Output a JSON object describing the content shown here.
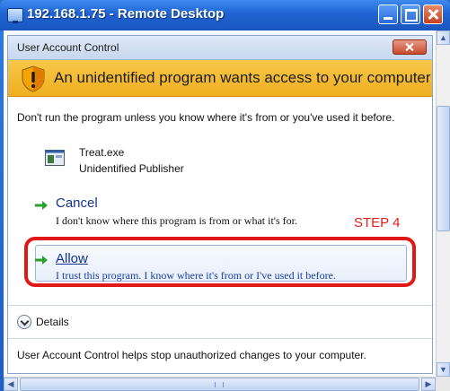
{
  "remote_desktop": {
    "title": "192.168.1.75 - Remote Desktop"
  },
  "uac": {
    "title": "User Account Control",
    "banner": "An unidentified program wants access to your computer",
    "warning": "Don't run the program unless you know where it's from or you've used it before.",
    "program": {
      "name": "Treat.exe",
      "publisher": "Unidentified Publisher"
    },
    "cancel": {
      "label": "Cancel",
      "description": "I don't know where this program is from or what it's for."
    },
    "allow": {
      "label": "Allow",
      "description": "I trust this program. I know where it's from or I've used it before."
    },
    "details_label": "Details",
    "footer": "User Account Control helps stop unauthorized changes to your computer."
  },
  "annotation": {
    "step_label": "STEP 4",
    "highlight_color": "#e01818"
  },
  "colors": {
    "banner": "#f2b62f",
    "link": "#14318e",
    "arrow": "#2aa12a"
  }
}
